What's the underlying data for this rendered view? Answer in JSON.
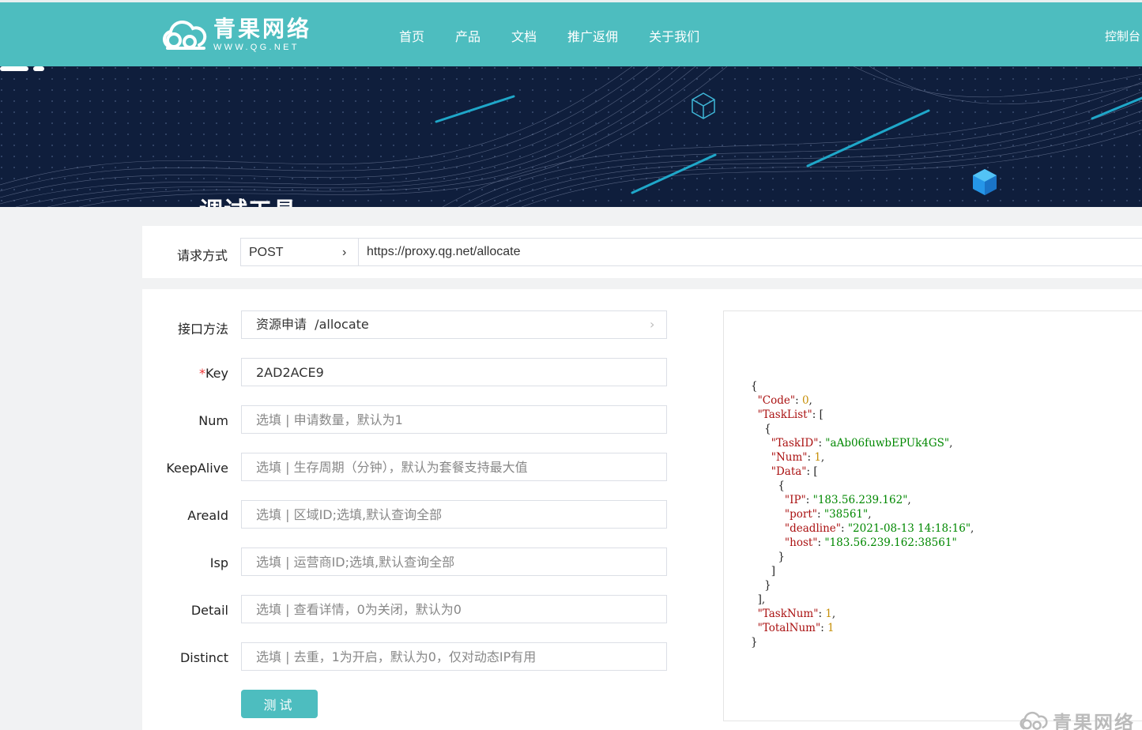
{
  "header": {
    "logo_cn": "青果网络",
    "logo_en": "WWW.QG.NET",
    "nav": [
      "首页",
      "产品",
      "文档",
      "推广返佣",
      "关于我们"
    ],
    "console": "控制台"
  },
  "banner": {
    "title": "调试工具"
  },
  "request": {
    "label": "请求方式",
    "method": "POST",
    "url": "https://proxy.qg.net/allocate"
  },
  "form": {
    "api_label": "接口方法",
    "api_value": "资源申请  /allocate",
    "fields": [
      {
        "label": "Key",
        "required": "*",
        "value": "2AD2ACE9",
        "placeholder": ""
      },
      {
        "label": "Num",
        "value": "",
        "placeholder": "选填 | 申请数量，默认为1"
      },
      {
        "label": "KeepAlive",
        "value": "",
        "placeholder": "选填 | 生存周期（分钟），默认为套餐支持最大值"
      },
      {
        "label": "AreaId",
        "value": "",
        "placeholder": "选填 | 区域ID;选填,默认查询全部"
      },
      {
        "label": "Isp",
        "value": "",
        "placeholder": "选填 | 运营商ID;选填,默认查询全部"
      },
      {
        "label": "Detail",
        "value": "",
        "placeholder": "选填 | 查看详情，0为关闭，默认为0"
      },
      {
        "label": "Distinct",
        "value": "",
        "placeholder": "选填 | 去重，1为开启，默认为0，仅对动态IP有用"
      }
    ],
    "submit": "测试"
  },
  "response": {
    "Code": "0",
    "TaskID": "aAb06fuwbEPUk4GS",
    "Num": "1",
    "IP": "183.56.239.162",
    "port": "38561",
    "deadline": "2021-08-13 14:18:16",
    "host": "183.56.239.162:38561",
    "TaskNum": "1",
    "TotalNum": "1"
  },
  "watermark": "青果网络",
  "colors": {
    "brand": "#4dbdbf",
    "banner_bg": "#0f1e3c"
  }
}
